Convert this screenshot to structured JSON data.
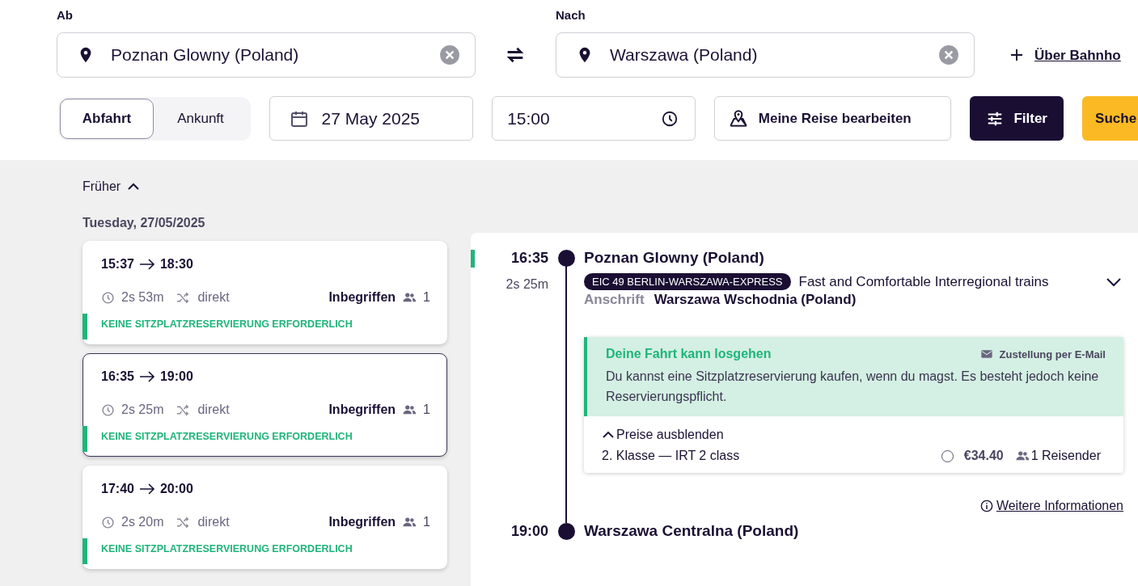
{
  "search": {
    "from": {
      "label": "Ab",
      "value": "Poznan Glowny (Poland)"
    },
    "to": {
      "label": "Nach",
      "value": "Warszawa (Poland)"
    },
    "via_link": "Über Bahnho",
    "mode_tabs": [
      {
        "label": "Abfahrt",
        "selected": true
      },
      {
        "label": "Ankunft",
        "selected": false
      }
    ],
    "date": "27 May 2025",
    "time": "15:00",
    "edit_button": "Meine Reise bearbeiten",
    "filter_button": "Filter",
    "search_button": "Suche"
  },
  "results": {
    "earlier": "Früher",
    "date_heading": "Tuesday, 27/05/2025",
    "journeys": [
      {
        "departure": "15:37",
        "arrival": "18:30",
        "duration": "2s 53m",
        "changes": "direkt",
        "fare": "Inbegriffen",
        "passengers": "1",
        "note": "KEINE SITZPLATZRESERVIERUNG ERFORDERLICH",
        "selected": false
      },
      {
        "departure": "16:35",
        "arrival": "19:00",
        "duration": "2s 25m",
        "changes": "direkt",
        "fare": "Inbegriffen",
        "passengers": "1",
        "note": "KEINE SITZPLATZRESERVIERUNG ERFORDERLICH",
        "selected": true
      },
      {
        "departure": "17:40",
        "arrival": "20:00",
        "duration": "2s 20m",
        "changes": "direkt",
        "fare": "Inbegriffen",
        "passengers": "1",
        "note": "KEINE SITZPLATZRESERVIERUNG ERFORDERLICH",
        "selected": false
      }
    ]
  },
  "details": {
    "departure_time": "16:35",
    "departure_station": "Poznan Glowny (Poland)",
    "duration": "2s 25m",
    "train_badge": "EIC 49 BERLIN-WARSZAWA-EXPRESS",
    "train_description": "Fast and Comfortable Interregional trains",
    "direction_label": "Anschrift",
    "direction_station": "Warszawa Wschodnia (Poland)",
    "notice": {
      "title": "Deine Fahrt kann losgehen",
      "delivery": "Zustellung per E-Mail",
      "text": "Du kannst eine Sitzplatzreservierung kaufen, wenn du magst. Es besteht jedoch keine Reservierungspflicht."
    },
    "prices_toggle": "Preise ausblenden",
    "fares": [
      {
        "name": "2. Klasse — IRT 2 class",
        "selected": false,
        "price": "€34.40",
        "passengers": "1 Reisender"
      }
    ],
    "more_info": "Weitere Informationen",
    "arrival_time": "19:00",
    "arrival_station": "Warszawa Centralna (Poland)"
  }
}
